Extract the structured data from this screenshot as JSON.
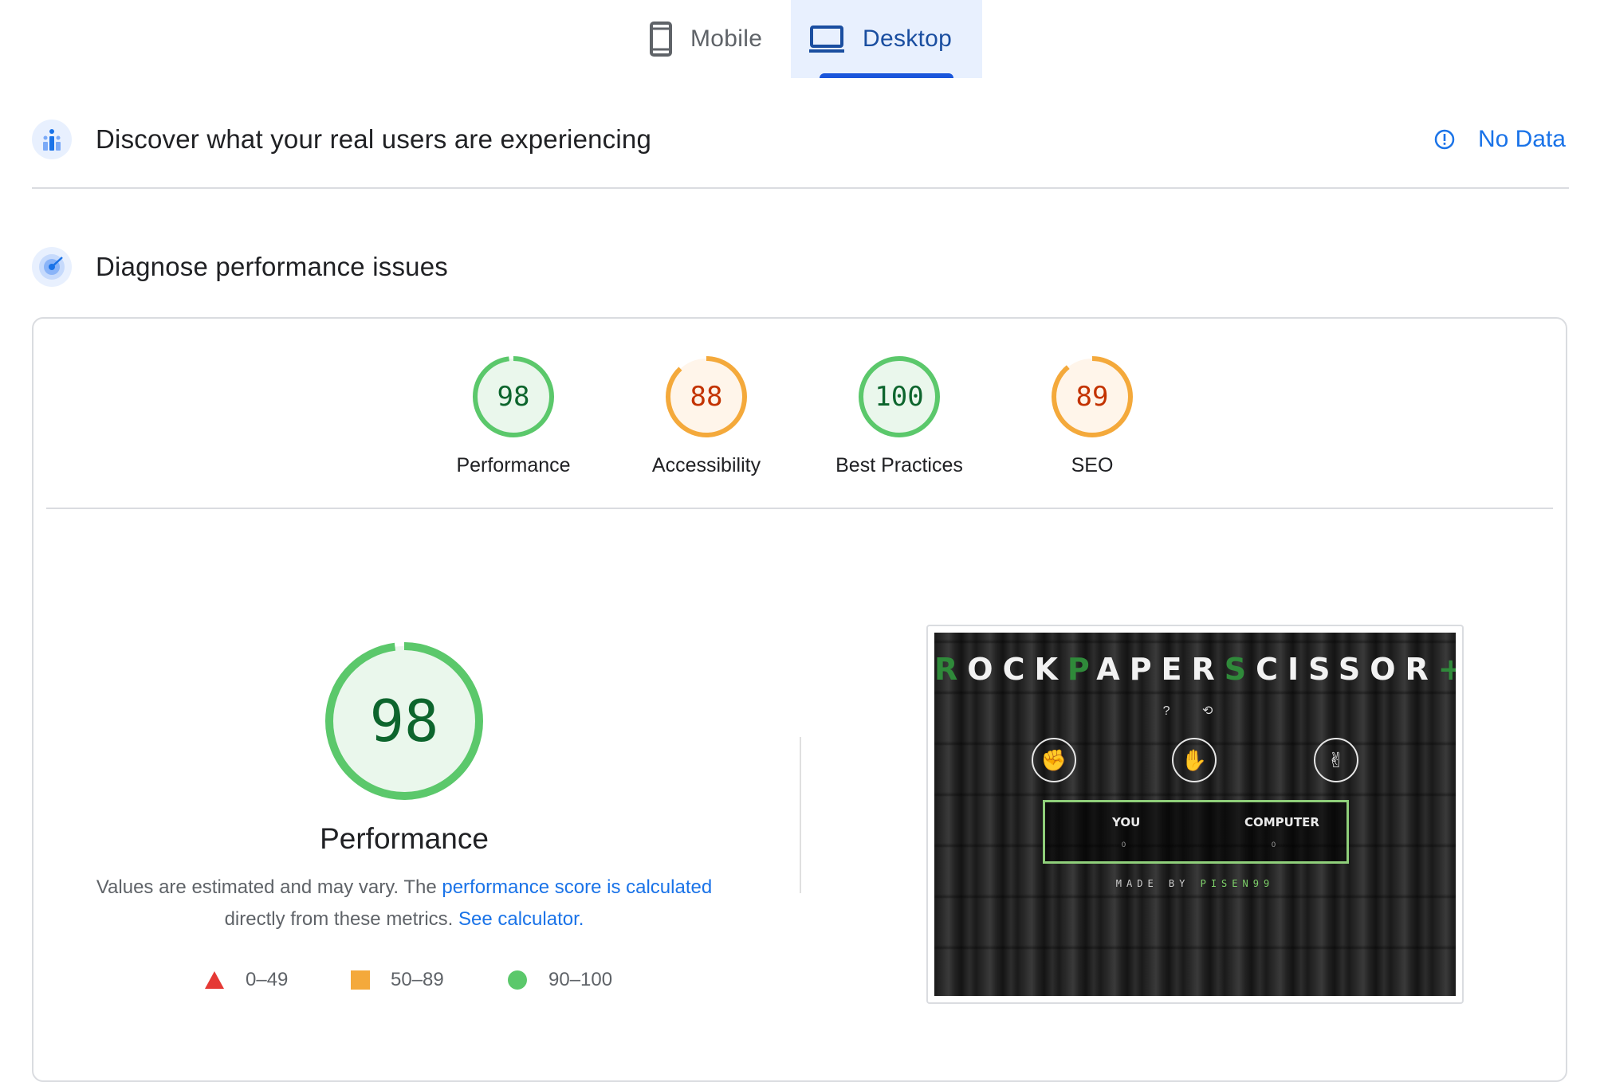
{
  "tabs": {
    "mobile": {
      "label": "Mobile",
      "icon": "mobile-phone-icon"
    },
    "desktop": {
      "label": "Desktop",
      "icon": "laptop-icon",
      "selected": true
    }
  },
  "field_data": {
    "title": "Discover what your real users are experiencing",
    "status": "No Data",
    "icon": "users-chart-icon",
    "status_icon": "info-icon"
  },
  "diagnose": {
    "title": "Diagnose performance issues",
    "icon": "target-icon"
  },
  "categories": [
    {
      "label": "Performance",
      "score": "98",
      "rating": "pass"
    },
    {
      "label": "Accessibility",
      "score": "88",
      "rating": "average"
    },
    {
      "label": "Best Practices",
      "score": "100",
      "rating": "pass"
    },
    {
      "label": "SEO",
      "score": "89",
      "rating": "average"
    }
  ],
  "performance": {
    "score": "98",
    "title": "Performance",
    "desc_prefix": "Values are estimated and may vary. The ",
    "desc_link1": "performance score is calculated",
    "desc_middle": "directly from these metrics. ",
    "desc_link2": "See calculator."
  },
  "legend": [
    {
      "range": "0–49",
      "shape": "triangle",
      "color": "#e53935"
    },
    {
      "range": "50–89",
      "shape": "square",
      "color": "#f4a93b"
    },
    {
      "range": "90–100",
      "shape": "circle",
      "color": "#5bc86b"
    }
  ],
  "colors": {
    "pass": "#5bc86b",
    "pass_text": "#0d652d",
    "pass_fill": "#eaf7ec",
    "average": "#f4a93b",
    "average_text": "#c33300",
    "average_fill": "#fff5ea",
    "accent": "#1a73e8"
  },
  "screenshot": {
    "title_letters": [
      "R",
      "OCK",
      "P",
      "APER",
      "S",
      "CISSOR",
      "+"
    ],
    "help": "? ⟲",
    "you_label": "YOU",
    "you_score": "0",
    "computer_label": "COMPUTER",
    "computer_score": "0",
    "made_by": "MADE BY",
    "author": "PISEN99"
  }
}
